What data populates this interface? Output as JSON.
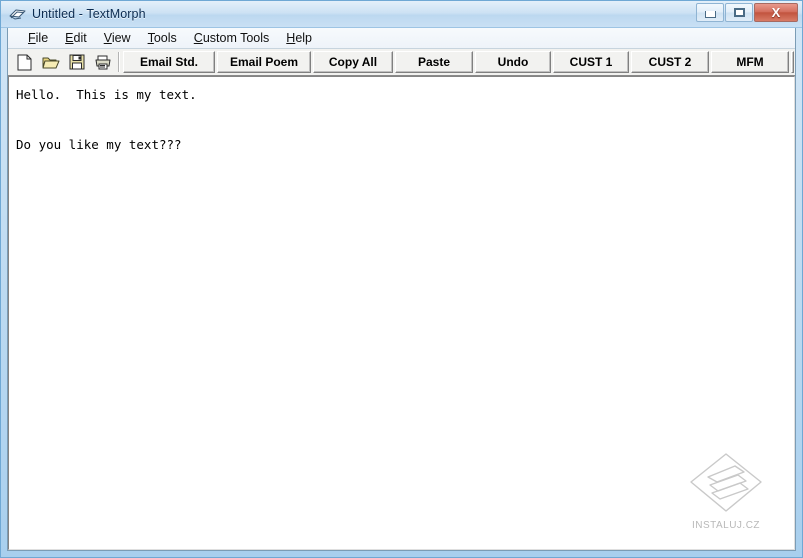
{
  "window": {
    "title": "Untitled - TextMorph",
    "app_icon": "textmorph-ribbon-icon",
    "controls": {
      "minimize": "minimize-button",
      "maximize": "maximize-button",
      "close_glyph": "X"
    }
  },
  "menubar": {
    "items": [
      {
        "label": "File",
        "accel": "F"
      },
      {
        "label": "Edit",
        "accel": "E"
      },
      {
        "label": "View",
        "accel": "V"
      },
      {
        "label": "Tools",
        "accel": "T"
      },
      {
        "label": "Custom Tools",
        "accel": "C"
      },
      {
        "label": "Help",
        "accel": "H"
      }
    ]
  },
  "toolbar": {
    "icons": [
      {
        "name": "new-document-icon"
      },
      {
        "name": "open-folder-icon"
      },
      {
        "name": "save-floppy-icon"
      },
      {
        "name": "print-icon"
      }
    ],
    "buttons": [
      {
        "label": "Email Std."
      },
      {
        "label": "Email Poem"
      },
      {
        "label": "Copy All"
      },
      {
        "label": "Paste"
      },
      {
        "label": "Undo"
      },
      {
        "label": "CUST 1"
      },
      {
        "label": "CUST 2"
      },
      {
        "label": "MFM"
      }
    ]
  },
  "editor": {
    "content": "Hello.  This is my text.\n\nDo you like my text???"
  },
  "watermark": {
    "label": "INSTALUJ.CZ"
  },
  "colors": {
    "frame": "#c2ddf2",
    "titlebar_top": "#e4f0fa",
    "close_button": "#d4705f",
    "toolbar_face": "#f2f2f0",
    "editor_background": "#ffffff"
  }
}
